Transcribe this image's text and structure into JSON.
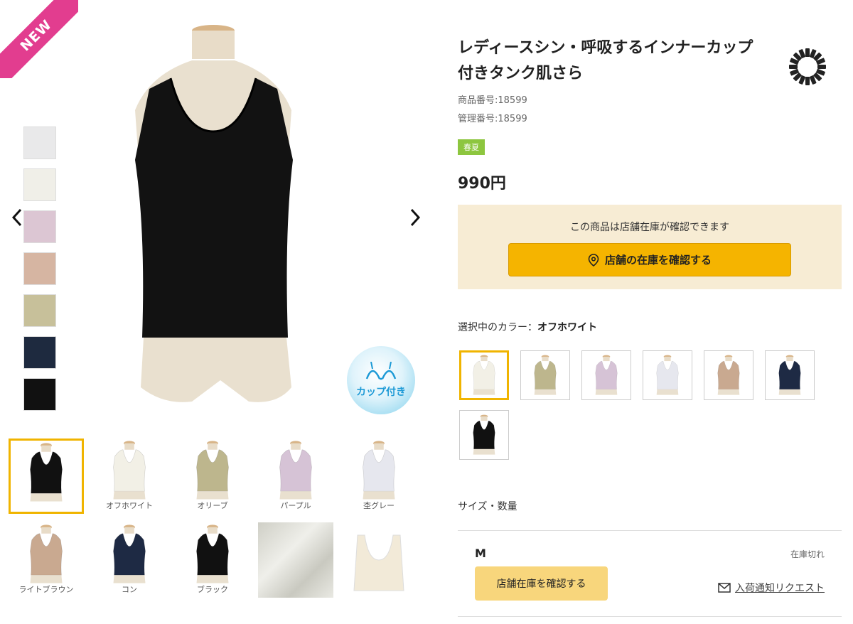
{
  "badges": {
    "new": "NEW",
    "cup": "カップ付き",
    "season": "春夏"
  },
  "gallery": {
    "swatches": [
      "#e9e9ea",
      "#f0efe8",
      "#dcc6d3",
      "#d6b5a2",
      "#c7c09a",
      "#1e2a3f",
      "#111111"
    ],
    "thumbnails": [
      {
        "label": "",
        "color": "#111111",
        "selected": true
      },
      {
        "label": "オフホワイト",
        "color": "#f2f0e6",
        "selected": false
      },
      {
        "label": "オリーブ",
        "color": "#bdb68d",
        "selected": false
      },
      {
        "label": "パープル",
        "color": "#d6c3d6",
        "selected": false
      },
      {
        "label": "杢グレー",
        "color": "#e6e7ee",
        "selected": false
      },
      {
        "label": "ライトブラウン",
        "color": "#c9a990",
        "selected": false
      },
      {
        "label": "コン",
        "color": "#1e2a44",
        "selected": false
      },
      {
        "label": "ブラック",
        "color": "#111111",
        "selected": false
      },
      {
        "label": "",
        "color": "#dcdcd4",
        "selected": false
      },
      {
        "label": "",
        "color": "#f2ead8",
        "selected": false
      }
    ]
  },
  "product": {
    "title_line1": "レディースシン・呼吸するインナーカップ",
    "title_line2": "付きタンク肌さら",
    "item_number": "商品番号:18599",
    "control_number": "管理番号:18599",
    "price": "990円"
  },
  "stock_check": {
    "message": "この商品は店舗在庫が確認できます",
    "button": "店舗の在庫を確認する"
  },
  "color_select": {
    "label": "選択中のカラー：",
    "value": "オフホワイト",
    "options": [
      "#f2f0e6",
      "#bdb68d",
      "#d6c3d6",
      "#e6e7ee",
      "#c9a990",
      "#1e2a44",
      "#111111"
    ]
  },
  "size_section": {
    "label": "サイズ・数量",
    "size": "M",
    "status": "在庫切れ",
    "store_button": "店舗在庫を確認する",
    "notify_link": "入荷通知リクエスト"
  },
  "colors": {
    "accent": "#f5b400",
    "new_pink": "#e23d8f",
    "season_green": "#8dc63f",
    "stock_bg": "#f7ecd4"
  }
}
